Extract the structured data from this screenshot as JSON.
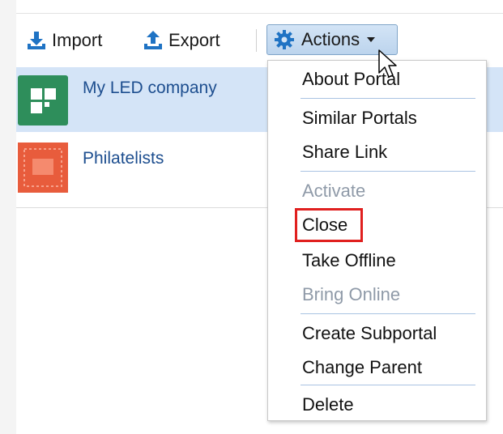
{
  "toolbar": {
    "import_label": "Import",
    "export_label": "Export",
    "actions_label": "Actions",
    "import_icon": "download-arrow-icon",
    "export_icon": "upload-arrow-icon",
    "actions_icon": "gear-icon",
    "caret_icon": "caret-down-icon"
  },
  "portals": [
    {
      "title": "My LED company",
      "thumbnail_icon": "tile-grid-icon",
      "selected": true
    },
    {
      "title": "Philatelists",
      "thumbnail_icon": "stamp-image",
      "selected": false
    }
  ],
  "actions_menu": {
    "items": [
      {
        "label": "About Portal",
        "enabled": true
      },
      {
        "label": "Similar Portals",
        "enabled": true
      },
      {
        "label": "Share Link",
        "enabled": true
      },
      {
        "label": "Activate",
        "enabled": false
      },
      {
        "label": "Close",
        "enabled": true,
        "highlighted": true
      },
      {
        "label": "Take Offline",
        "enabled": true
      },
      {
        "label": "Bring Online",
        "enabled": false
      },
      {
        "label": "Create Subportal",
        "enabled": true
      },
      {
        "label": "Change Parent",
        "enabled": true
      },
      {
        "label": "Delete",
        "enabled": true
      }
    ]
  },
  "colors": {
    "accent_blue": "#1f73c4",
    "selected_row": "#d4e4f7",
    "link_text": "#1d4e8f",
    "disabled_text": "#8f9aa8",
    "highlight_border": "#e0201f",
    "thumb_green": "#2e8e5b",
    "thumb_red": "#e85c3c"
  }
}
